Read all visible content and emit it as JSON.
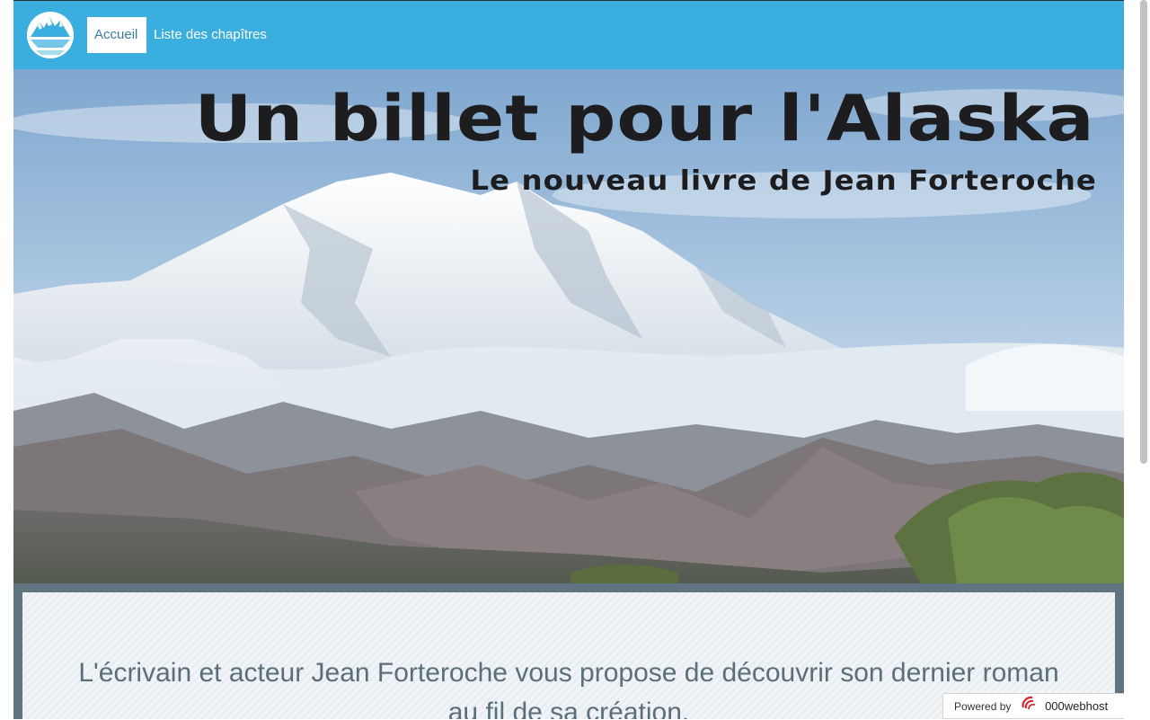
{
  "nav": {
    "logo_name": "mountain-logo-icon",
    "items": [
      {
        "label": "Accueil",
        "active": true
      },
      {
        "label": "Liste des chapîtres",
        "active": false
      }
    ]
  },
  "hero": {
    "title": "Un billet pour l'Alaska",
    "subtitle": "Le nouveau livre de Jean Forteroche"
  },
  "content": {
    "intro": "L'écrivain et acteur Jean Forteroche vous propose de découvrir son dernier roman au fil de sa création."
  },
  "badge": {
    "powered_by": "Powered by",
    "brand": "000webhost"
  },
  "colors": {
    "navbar": "#3aaede",
    "page_frame": "#5f7380",
    "title_text": "#1d1d20",
    "intro_text": "#5b6f7b"
  }
}
